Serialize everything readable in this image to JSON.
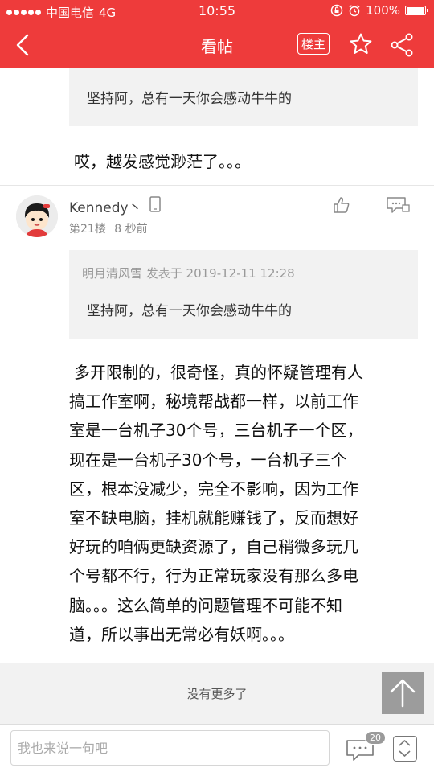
{
  "status_bar": {
    "carrier": "中国电信",
    "network": "4G",
    "time": "10:55",
    "battery": "100%",
    "battery_level": 1.0
  },
  "nav": {
    "title": "看帖",
    "louzhu_label": "楼主"
  },
  "top_snippet": {
    "quote_text": "坚持阿，总有一天你会感动牛牛的",
    "reply": "哎，越发感觉渺茫了。。。"
  },
  "post": {
    "username": "Kennedy丶",
    "floor": "第21楼",
    "time": "8 秒前",
    "quote_meta": "明月清风雪 发表于 2019-12-11 12:28",
    "quote_text": "坚持阿，总有一天你会感动牛牛的",
    "body_lines": [
      "多开限制的，很奇怪，真的怀疑管理有人",
      "搞工作室啊，秘境帮战都一样，以前工作",
      "室是一台机子30个号，三台机子一个区，",
      "现在是一台机子30个号，一台机子三个",
      "区，根本没减少，完全不影响，因为工作",
      "室不缺电脑，挂机就能赚钱了，反而想好",
      "好玩的咱俩更缺资源了，自己稍微多玩几",
      "个号都不行，行为正常玩家没有那么多电",
      "脑。。。这么简单的问题管理不可能不知",
      "道，所以事出无常必有妖啊。。。"
    ]
  },
  "footer": {
    "no_more": "没有更多了",
    "input_placeholder": "我也来说一句吧",
    "comment_count": "20"
  },
  "colors": {
    "brand": "#ee3b3b"
  }
}
